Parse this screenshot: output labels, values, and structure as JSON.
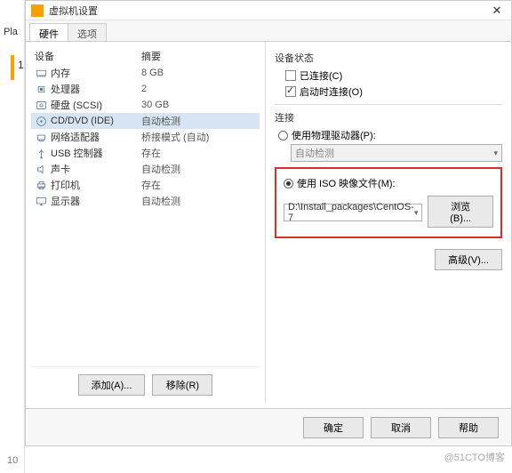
{
  "leftStrip": {
    "pla": "Pla",
    "num": "1"
  },
  "title": "虚拟机设置",
  "tabs": {
    "hardware": "硬件",
    "options": "选项"
  },
  "hwHeader": {
    "device": "设备",
    "summary": "摘要"
  },
  "hw": [
    {
      "name": "内存",
      "summary": "8 GB",
      "icon": "memory"
    },
    {
      "name": "处理器",
      "summary": "2",
      "icon": "cpu"
    },
    {
      "name": "硬盘 (SCSI)",
      "summary": "30 GB",
      "icon": "disk"
    },
    {
      "name": "CD/DVD (IDE)",
      "summary": "自动检测",
      "icon": "cd",
      "selected": true
    },
    {
      "name": "网络适配器",
      "summary": "桥接模式 (自动)",
      "icon": "net"
    },
    {
      "name": "USB 控制器",
      "summary": "存在",
      "icon": "usb"
    },
    {
      "name": "声卡",
      "summary": "自动检测",
      "icon": "sound"
    },
    {
      "name": "打印机",
      "summary": "存在",
      "icon": "printer"
    },
    {
      "name": "显示器",
      "summary": "自动检测",
      "icon": "display"
    }
  ],
  "hwBtns": {
    "add": "添加(A)...",
    "remove": "移除(R)"
  },
  "right": {
    "status": "设备状态",
    "connected": "已连接(C)",
    "connectAtPowerOn": "启动时连接(O)",
    "connection": "连接",
    "usePhysical": "使用物理驱动器(P):",
    "autoDetect": "自动检测",
    "useIso": "使用 ISO 映像文件(M):",
    "isoPath": "D:\\Install_packages\\CentOS-7",
    "browse": "浏览(B)...",
    "advanced": "高级(V)..."
  },
  "footer": {
    "ok": "确定",
    "cancel": "取消",
    "help": "帮助"
  },
  "watermark": "@51CTO博客",
  "bl": "10"
}
